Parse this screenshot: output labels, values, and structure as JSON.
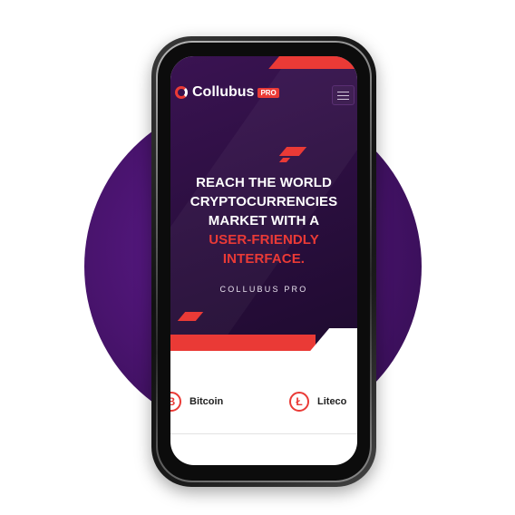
{
  "brand": {
    "name": "Collubus",
    "badge": "PRO"
  },
  "menu": {
    "icon": "hamburger-menu-icon"
  },
  "hero": {
    "headline_lines": [
      "REACH THE WORLD",
      "CRYPTOCURRENCIES",
      "MARKET WITH A"
    ],
    "headline_accent": "USER-FRIENDLY INTERFACE.",
    "subtitle": "COLLUBUS PRO"
  },
  "coins": [
    {
      "name": "Bitcoin",
      "icon": "bitcoin-icon",
      "symbol": "B"
    },
    {
      "name": "Liteco",
      "icon": "litecoin-icon",
      "symbol": "Ł"
    }
  ],
  "colors": {
    "accent": "#ea3a36",
    "hero_bg": "#2a0e3e",
    "circle_bg": "#4a146f"
  }
}
